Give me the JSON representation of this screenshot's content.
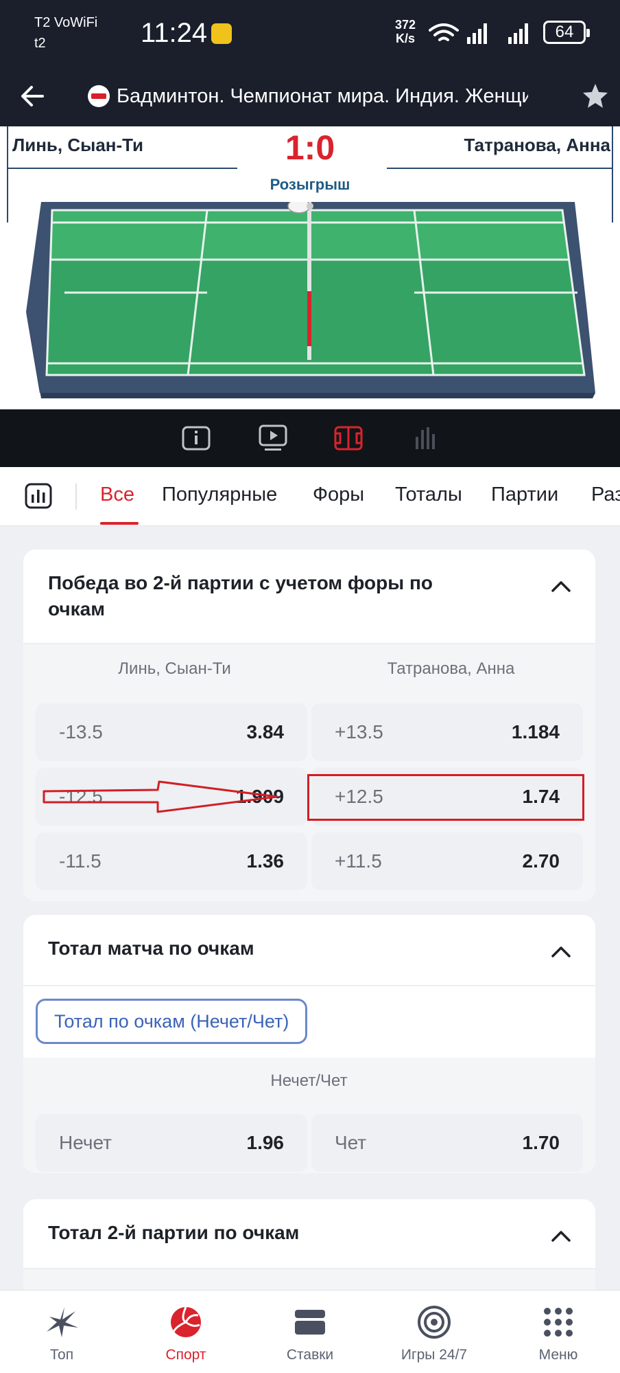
{
  "status_bar": {
    "carrier": "T2 VoWiFi",
    "vowifi_badge": "VoWiFi",
    "carrier2": "t2",
    "time": "11:24",
    "net_speed_value": "372",
    "net_speed_unit": "K/s",
    "battery": "64"
  },
  "header": {
    "title": "Бадминтон. Чемпионат мира. Индия. Женщи..."
  },
  "scoreboard": {
    "player1": "Линь, Сыан-Ти",
    "player2": "Татранова, Анна",
    "score": "1:0",
    "status": "Розыгрыш"
  },
  "tabs": {
    "items": [
      "Все",
      "Популярные",
      "Форы",
      "Тоталы",
      "Партии",
      "Раз"
    ],
    "active_index": 0
  },
  "market_handicap": {
    "title_line1": "Победа во 2-й партии с учетом форы по",
    "title_line2": "очкам",
    "col1": "Линь, Сыан-Ти",
    "col2": "Татранова, Анна",
    "rows": [
      {
        "left_param": "-13.5",
        "left_odd": "3.84",
        "right_param": "+13.5",
        "right_odd": "1.184"
      },
      {
        "left_param": "-12.5",
        "left_odd": "1.909",
        "right_param": "+12.5",
        "right_odd": "1.74"
      },
      {
        "left_param": "-11.5",
        "left_odd": "1.36",
        "right_param": "+11.5",
        "right_odd": "2.70"
      }
    ]
  },
  "market_total": {
    "title": "Тотал матча по очкам",
    "chip": "Тотал по очкам (Нечет/Чет)",
    "sub_header": "Нечет/Чет",
    "left_label": "Нечет",
    "left_odd": "1.96",
    "right_label": "Чет",
    "right_odd": "1.70"
  },
  "market_total2": {
    "title": "Тотал 2-й партии по очкам"
  },
  "bottom_nav": {
    "items": [
      "Топ",
      "Спорт",
      "Ставки",
      "Игры 24/7",
      "Меню"
    ],
    "active_index": 1
  },
  "colors": {
    "accent": "#d9232d",
    "dark_bar": "#1a1f2b",
    "chip_blue": "#3a63b8",
    "annotation_red": "#d21e24"
  }
}
